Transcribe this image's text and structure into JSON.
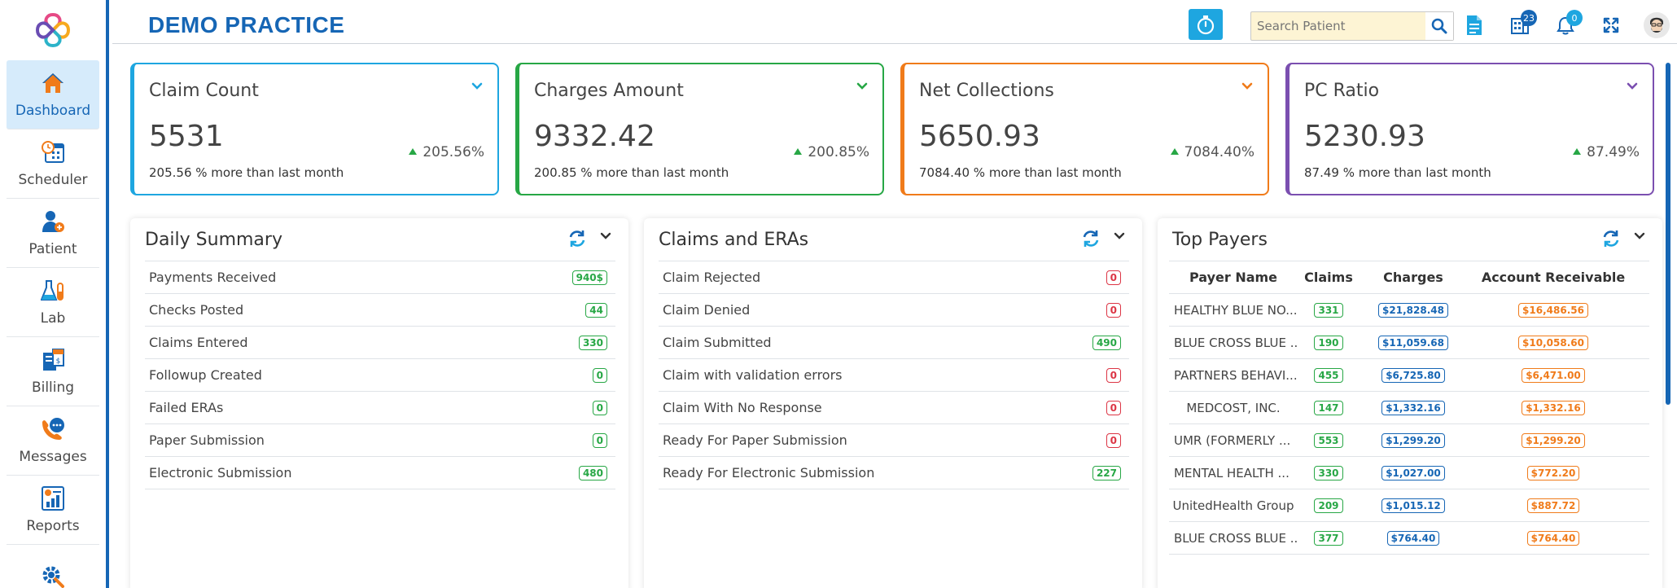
{
  "app": {
    "title": "DEMO PRACTICE"
  },
  "sidebar": {
    "items": [
      {
        "label": "Dashboard",
        "icon": "home-icon"
      },
      {
        "label": "Scheduler",
        "icon": "calendar-clock-icon"
      },
      {
        "label": "Patient",
        "icon": "patient-icon"
      },
      {
        "label": "Lab",
        "icon": "flask-icon"
      },
      {
        "label": "Billing",
        "icon": "billing-icon"
      },
      {
        "label": "Messages",
        "icon": "messages-icon"
      },
      {
        "label": "Reports",
        "icon": "reports-icon"
      },
      {
        "label": "",
        "icon": "settings-gear-icon"
      }
    ]
  },
  "header": {
    "search_placeholder": "Search Patient",
    "badges": {
      "building": "23",
      "bell": "0"
    }
  },
  "colors": {
    "primary": "#1666b5",
    "teal": "#1ea6e0",
    "green": "#27a745",
    "orange": "#f07b1a",
    "purple": "#7b4fb0",
    "red": "#dc3545"
  },
  "stats": [
    {
      "title": "Claim Count",
      "value": "5531",
      "pct": "205.56%",
      "sub": "205.56 % more than last month"
    },
    {
      "title": "Charges Amount",
      "value": "9332.42",
      "pct": "200.85%",
      "sub": "200.85 % more than last month"
    },
    {
      "title": "Net Collections",
      "value": "5650.93",
      "pct": "7084.40%",
      "sub": "7084.40 % more than last month"
    },
    {
      "title": "PC Ratio",
      "value": "5230.93",
      "pct": "87.49%",
      "sub": "87.49 % more than last month"
    }
  ],
  "daily_summary": {
    "title": "Daily Summary",
    "rows": [
      {
        "label": "Payments Received",
        "value": "940$"
      },
      {
        "label": "Checks Posted",
        "value": "44"
      },
      {
        "label": "Claims Entered",
        "value": "330"
      },
      {
        "label": "Followup Created",
        "value": "0"
      },
      {
        "label": "Failed ERAs",
        "value": "0"
      },
      {
        "label": "Paper Submission",
        "value": "0"
      },
      {
        "label": "Electronic Submission",
        "value": "480"
      }
    ]
  },
  "claims_eras": {
    "title": "Claims and ERAs",
    "rows": [
      {
        "label": "Claim Rejected",
        "value": "0"
      },
      {
        "label": "Claim Denied",
        "value": "0"
      },
      {
        "label": "Claim Submitted",
        "value": "490"
      },
      {
        "label": "Claim with validation errors",
        "value": "0"
      },
      {
        "label": "Claim With No Response",
        "value": "0"
      },
      {
        "label": "Ready For Paper Submission",
        "value": "0"
      },
      {
        "label": "Ready For Electronic Submission",
        "value": "227"
      }
    ]
  },
  "top_payers": {
    "title": "Top Payers",
    "headers": [
      "Payer Name",
      "Claims",
      "Charges",
      "Account Receivable"
    ],
    "rows": [
      {
        "name": "HEALTHY BLUE NO...",
        "claims": "331",
        "charges": "$21,828.48",
        "ar": "$16,486.56"
      },
      {
        "name": "BLUE CROSS BLUE ...",
        "claims": "190",
        "charges": "$11,059.68",
        "ar": "$10,058.60"
      },
      {
        "name": "PARTNERS BEHAVI...",
        "claims": "455",
        "charges": "$6,725.80",
        "ar": "$6,471.00"
      },
      {
        "name": "MEDCOST, INC.",
        "claims": "147",
        "charges": "$1,332.16",
        "ar": "$1,332.16"
      },
      {
        "name": "UMR (FORMERLY ...",
        "claims": "553",
        "charges": "$1,299.20",
        "ar": "$1,299.20"
      },
      {
        "name": "MENTAL HEALTH ...",
        "claims": "330",
        "charges": "$1,027.00",
        "ar": "$772.20"
      },
      {
        "name": "UnitedHealth Group",
        "claims": "209",
        "charges": "$1,015.12",
        "ar": "$887.72"
      },
      {
        "name": "BLUE CROSS BLUE ...",
        "claims": "377",
        "charges": "$764.40",
        "ar": "$764.40"
      }
    ]
  }
}
